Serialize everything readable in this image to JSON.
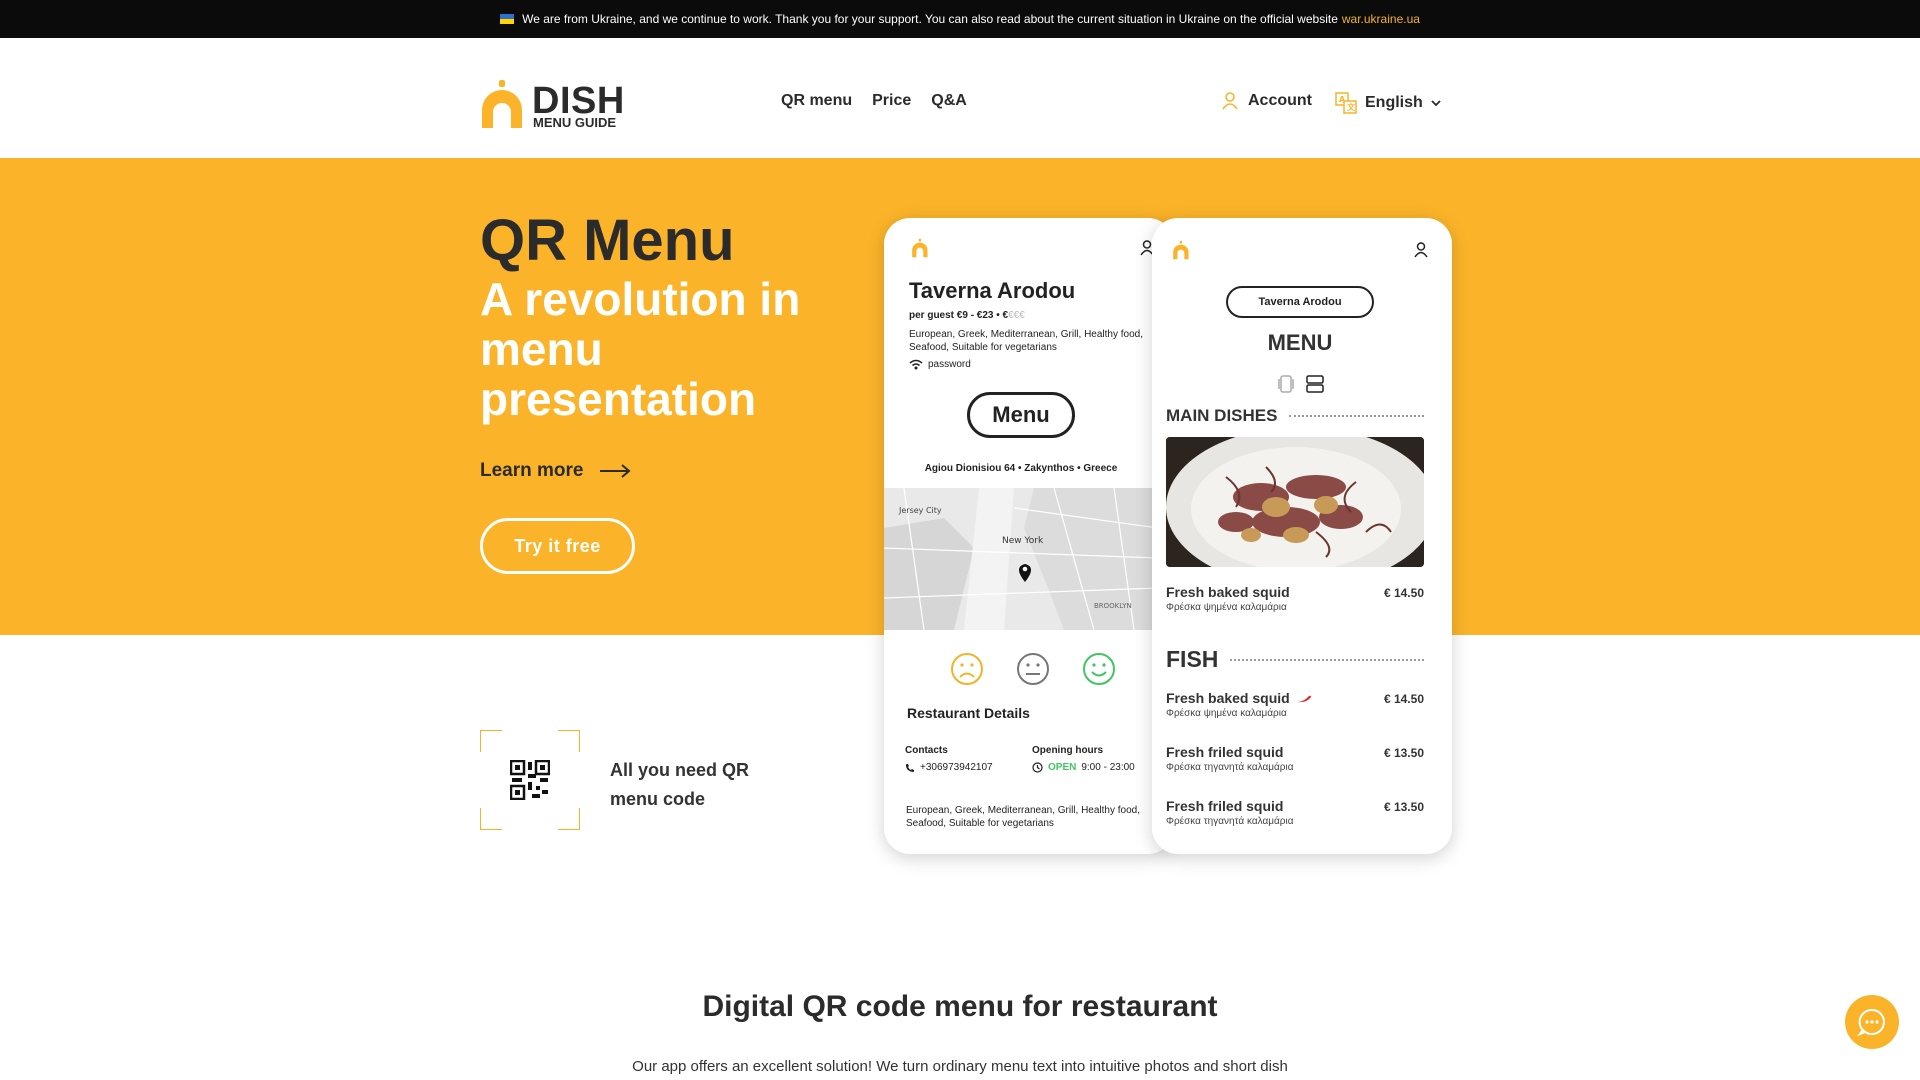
{
  "banner": {
    "text": "We are from Ukraine, and we continue to work. Thank you for your support. You can also read about the current situation in Ukraine on the official website",
    "link": "war.ukraine.ua"
  },
  "logo": {
    "word": "DISH",
    "sub": "MENU GUIDE"
  },
  "nav": {
    "qr_menu": "QR menu",
    "price": "Price",
    "qa": "Q&A"
  },
  "header": {
    "account": "Account",
    "language": "English"
  },
  "hero": {
    "title": "QR Menu",
    "subtitle": "A revolution in menu presentation",
    "learn_more": "Learn more",
    "try_free": "Try it free"
  },
  "feature": {
    "text": "All you need QR menu code"
  },
  "section": {
    "title": "Digital QR code menu for restaurant",
    "text": "Our app offers an excellent solution! We turn ordinary menu text into intuitive photos and short dish"
  },
  "phone1": {
    "restaurant": "Taverna Arodou",
    "guest_price": "per guest €9 - €23 • €",
    "guest_price_dim": "€€€",
    "cuisine": "European, Greek, Mediterranean, Grill, Healthy food, Seafood, Suitable for vegetarians",
    "wifi": "password",
    "menu_button": "Menu",
    "address": "Agiou Dionisiou 64 • Zakynthos • Greece",
    "map_label_1": "Jersey City",
    "map_label_2": "New York",
    "map_label_3": "BROOKLYN",
    "details_title": "Restaurant Details",
    "contacts_label": "Contacts",
    "phone": "+306973942107",
    "hours_label": "Opening hours",
    "open": "OPEN",
    "hours": "9:00 - 23:00",
    "footer_cuisine": "European, Greek, Mediterranean, Grill, Healthy food, Seafood, Suitable for vegetarians"
  },
  "phone2": {
    "restaurant_pill": "Taverna Arodou",
    "menu_title": "MENU",
    "main_dishes": "MAIN DISHES",
    "fish": "FISH",
    "dishes": [
      {
        "name": "Fresh baked squid",
        "alt": "Φρέσκα ψημένα καλαμάρια",
        "price": "€ 14.50"
      },
      {
        "name": "Fresh baked squid",
        "alt": "Φρέσκα ψημένα καλαμάρια",
        "price": "€ 14.50"
      },
      {
        "name": "Fresh friled squid",
        "alt": "Φρέσκα τηγανητά καλαμάρια",
        "price": "€ 13.50"
      },
      {
        "name": "Fresh friled squid",
        "alt": "Φρέσκα τηγανητά καλαμάρια",
        "price": "€ 13.50"
      }
    ]
  },
  "colors": {
    "brand_yellow": "#fbb429",
    "dark": "#2b2b2b",
    "open_green": "#43c463"
  },
  "icons": [
    "flag-icon",
    "user-icon",
    "translate-icon",
    "chevron-down-icon",
    "arrow-right-icon",
    "qr-code-icon",
    "chat-icon",
    "wifi-icon",
    "phone-icon",
    "clock-icon",
    "map-pin-icon",
    "sad-face-icon",
    "neutral-face-icon",
    "happy-face-icon",
    "chili-icon"
  ]
}
